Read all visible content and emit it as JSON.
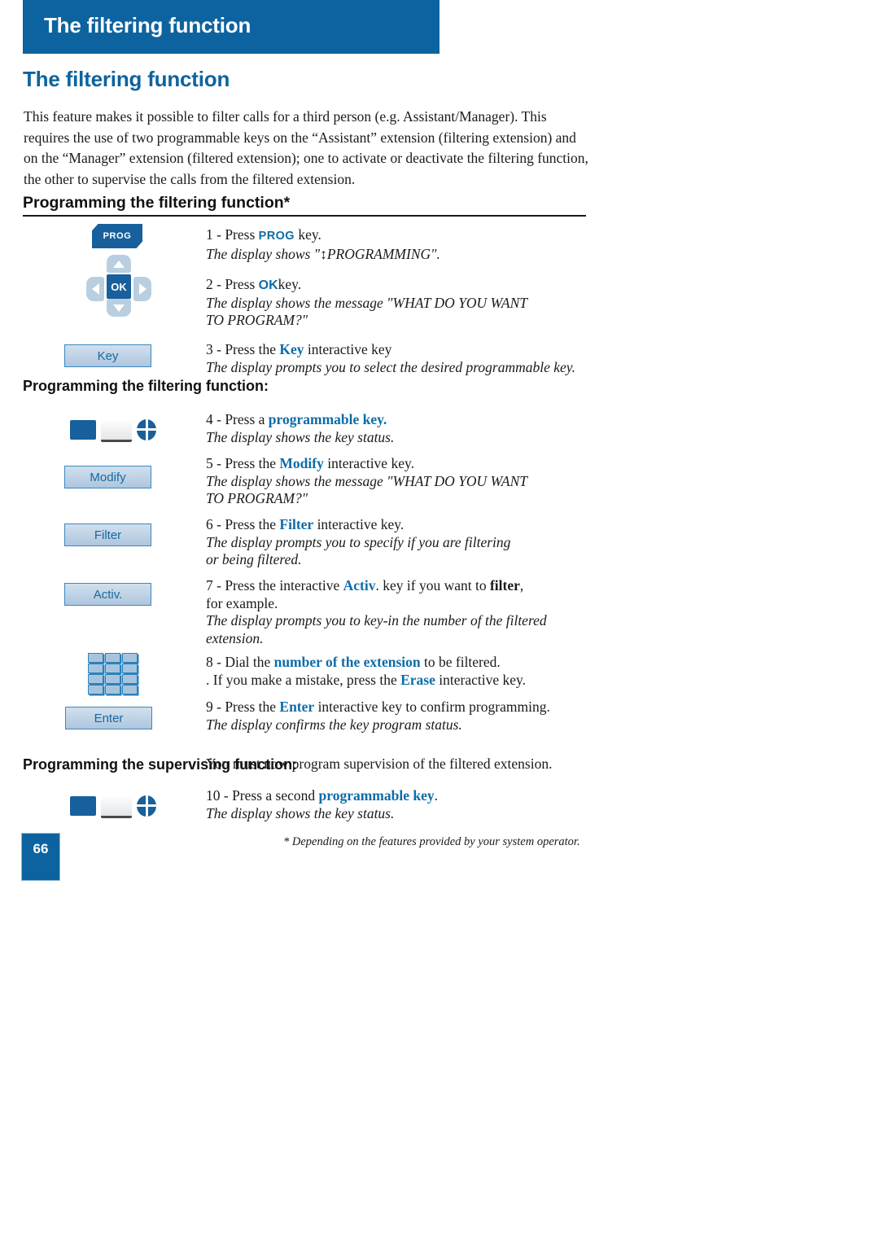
{
  "banner": {
    "title": "The filtering function"
  },
  "heading": {
    "h1": "The filtering function"
  },
  "intro": {
    "text": "This feature makes it possible to filter calls for a third person (e.g. Assistant/Manager). This requires the use of two programmable keys on the “Assistant” extension (filtering extension) and on the “Manager” extension (filtered extension); one to activate or deactivate the filtering function, the other to supervise the calls from the filtered extension."
  },
  "section": {
    "title": "Programming the filtering function*"
  },
  "labels": {
    "filtering": {
      "line1": "Programming",
      "line2": "the filtering function:"
    },
    "supervising": {
      "line1": "Programming",
      "line2": "the supervising function:"
    }
  },
  "icons": {
    "prog_key": "PROG",
    "ok_key": "OK",
    "nav_up": "up-arrow",
    "nav_down": "down-arrow",
    "nav_left": "left-arrow",
    "nav_right": "right-arrow",
    "programmable_key": "programmable-key-icon",
    "keypad": "numeric-keypad-icon"
  },
  "buttons": {
    "key": "Key",
    "modify": "Modify",
    "filter": "Filter",
    "activ": "Activ.",
    "enter": "Enter"
  },
  "steps": [
    {
      "num": "1 - Press",
      "key_inline": "PROG",
      "tail": "key.",
      "display": "The display shows \"↕PROGRAMMING\"."
    },
    {
      "num": "2 - Press",
      "key_inline": "OK",
      "tail": "key.",
      "display_l1": "The display shows the message \"WHAT DO YOU WANT",
      "display_l2": "TO PROGRAM?\""
    },
    {
      "pre": "3 - Press the",
      "kw": "Key",
      "post": "interactive key",
      "display": "The display prompts you to select the desired programmable key."
    },
    {
      "pre": "4 - Press a",
      "kw": "programmable key.",
      "post": "",
      "display": "The display shows the key status."
    },
    {
      "pre": "5 - Press the",
      "kw": "Modify",
      "post": "interactive key.",
      "display_l1": "The display shows the message \"WHAT DO YOU WANT",
      "display_l2": "TO PROGRAM?\""
    },
    {
      "pre": "6 - Press the",
      "kw": "Filter",
      "post": "interactive key.",
      "display_l1": "The display prompts you to specify if you are filtering",
      "display_l2": "or being filtered."
    },
    {
      "pre": "7 - Press the interactive",
      "kw": "Activ",
      "mid": ". key if you want to",
      "kwb": "filter",
      "post": ",",
      "line2": "for example.",
      "display_l1": "The display prompts you to key-in the number of the filtered",
      "display_l2": "extension."
    },
    {
      "pre": "8 - Dial the",
      "kw": "number of the extension",
      "post": "to be filtered.",
      "line2_pre": ". If you make a mistake, press the",
      "line2_kw": "Erase",
      "line2_post": "interactive key."
    },
    {
      "pre": "9 - Press the",
      "kw": "Enter",
      "post": "interactive key to confirm programming.",
      "display": "The display confirms the key program status."
    },
    {
      "intro": "You must now program supervision of the filtered extension."
    },
    {
      "pre": "10 - Press a second",
      "kw": "programmable key",
      "post": ".",
      "display": "The display shows the key status."
    }
  ],
  "page_number": "66",
  "footnote": "* Depending on the features provided by your system operator.",
  "colors": {
    "brand_blue": "#0d639f",
    "key_blue": "#17609c",
    "accent_blue": "#0d6ca8",
    "button_border": "#3a87bf",
    "nav_grey_blue": "#b9cfe0"
  }
}
